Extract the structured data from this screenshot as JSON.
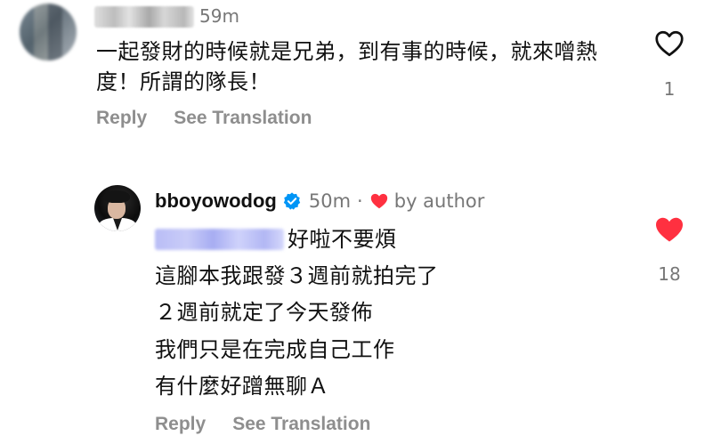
{
  "comment1": {
    "time": "59m",
    "text": "一起發財的時候就是兄弟，到有事的時候，就來噌熱度！所謂的隊長！",
    "likes": "1",
    "like_icon": "heart-outline-icon",
    "actions": {
      "reply": "Reply",
      "see_translation": "See Translation"
    }
  },
  "comment2": {
    "username": "bboyowodog",
    "verified_icon": "verified-badge-icon",
    "time": "50m",
    "separator": "·",
    "liked_by_author": "by author",
    "lines": [
      "好啦不要煩",
      "這腳本我跟發３週前就拍完了",
      "２週前就定了今天發佈",
      "我們只是在完成自己工作",
      "有什麼好蹭無聊Ａ"
    ],
    "likes": "18",
    "like_icon": "heart-filled-icon",
    "actions": {
      "reply": "Reply",
      "see_translation": "See Translation"
    }
  },
  "colors": {
    "text": "#111111",
    "secondary": "#777777",
    "action": "#8e8e8e",
    "like_red": "#ff3040",
    "verified_blue": "#0095f6"
  }
}
